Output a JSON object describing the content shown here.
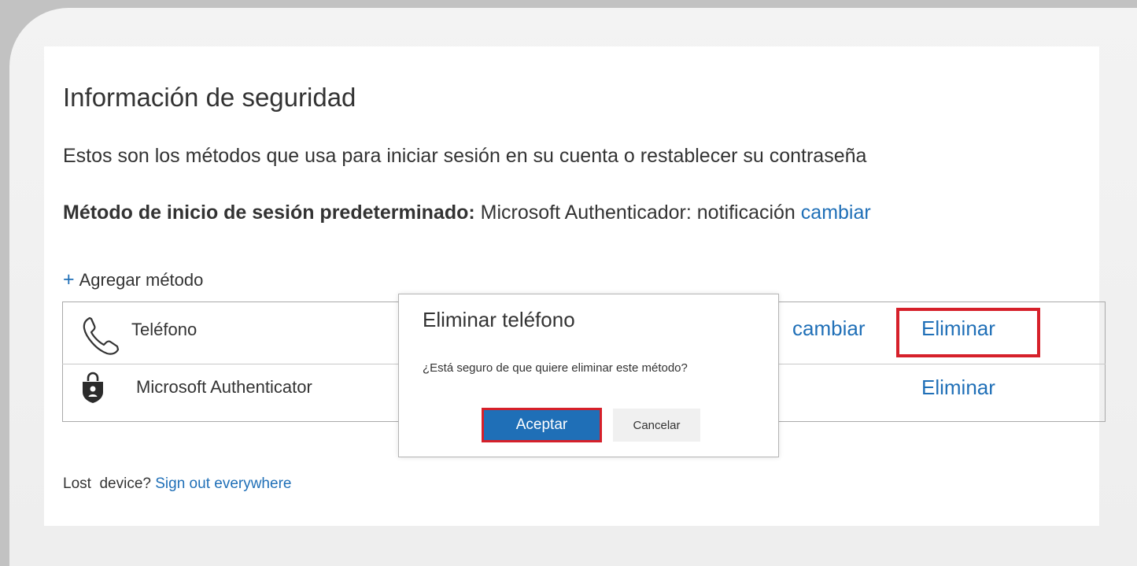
{
  "header": {
    "title": "Información de seguridad",
    "subtitle": "Estos son los métodos que usa para iniciar sesión en su cuenta o restablecer su contraseña"
  },
  "default_method": {
    "label": "Método de inicio de sesión predeterminado:",
    "value": " Microsoft Authenticador: notificación ",
    "change_link": "cambiar"
  },
  "add_method": {
    "icon": "plus-icon",
    "label": "Agregar método"
  },
  "methods": [
    {
      "icon": "phone-icon",
      "label": "Teléfono",
      "change_link": "cambiar",
      "delete_link": "Eliminar"
    },
    {
      "icon": "authenticator-lock-icon",
      "label": "Microsoft Authenticator",
      "delete_link": "Eliminar"
    }
  ],
  "dialog": {
    "title": "Eliminar teléfono",
    "message": "¿Está seguro de que quiere eliminar este método?",
    "accept_label": "Aceptar",
    "cancel_label": "Cancelar"
  },
  "footer": {
    "lost_device_text": "Lost  device? ",
    "sign_out_link": "Sign out everywhere"
  },
  "colors": {
    "link": "#1f6fb7",
    "primary_button": "#1f6fb7",
    "highlight": "#d6202a",
    "frame": "#c2c2c2"
  }
}
